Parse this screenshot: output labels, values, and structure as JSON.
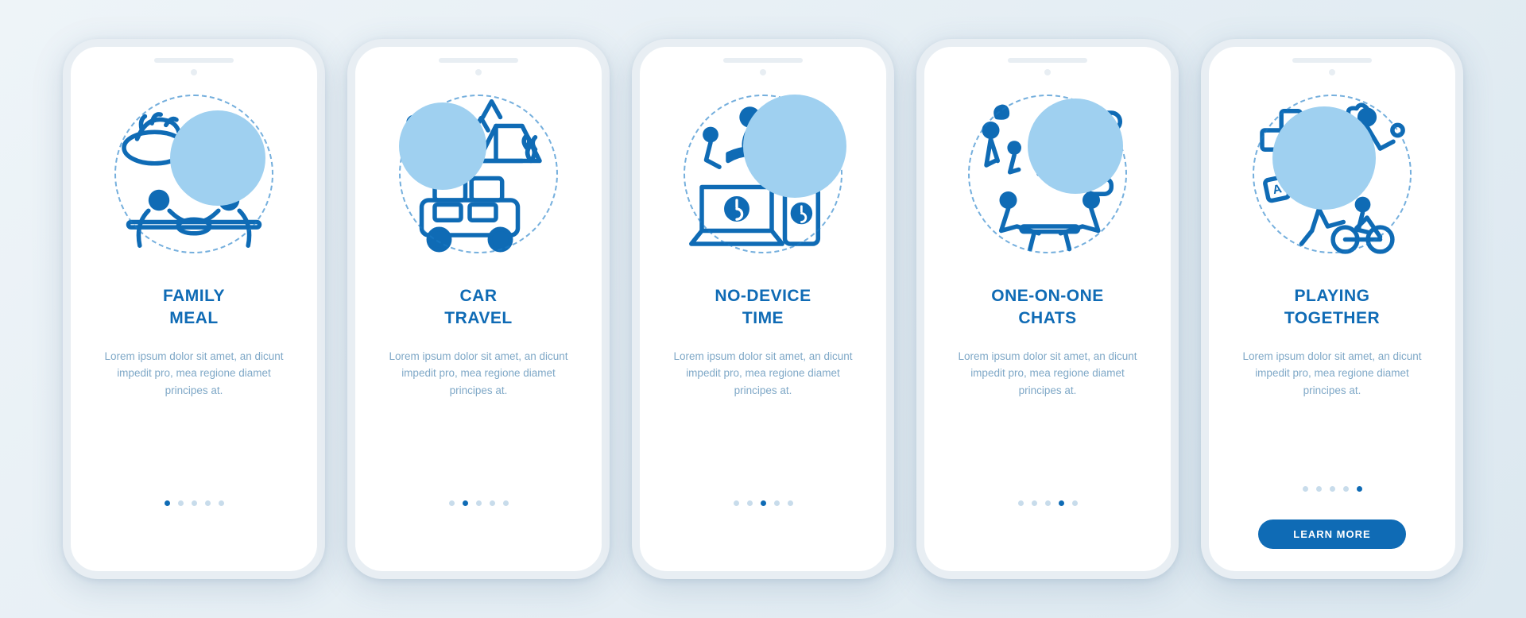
{
  "colors": {
    "accent": "#0f6bb5",
    "accentLight": "#9fd0f0",
    "muted": "#7fa8c7"
  },
  "screens": [
    {
      "id": "family-meal",
      "title": "FAMILY\nMEAL",
      "desc": "Lorem ipsum dolor sit amet, an dicunt impedit pro, mea regione diamet principes at.",
      "activeDot": 0
    },
    {
      "id": "car-travel",
      "title": "CAR\nTRAVEL",
      "desc": "Lorem ipsum dolor sit amet, an dicunt impedit pro, mea regione diamet principes at.",
      "activeDot": 1
    },
    {
      "id": "no-device-time",
      "title": "NO-DEVICE\nTIME",
      "desc": "Lorem ipsum dolor sit amet, an dicunt impedit pro, mea regione diamet principes at.",
      "activeDot": 2
    },
    {
      "id": "one-on-one-chats",
      "title": "ONE-ON-ONE\nCHATS",
      "desc": "Lorem ipsum dolor sit amet, an dicunt impedit pro, mea regione diamet principes at.",
      "activeDot": 3
    },
    {
      "id": "playing-together",
      "title": "PLAYING\nTOGETHER",
      "desc": "Lorem ipsum dolor sit amet, an dicunt impedit pro, mea regione diamet principes at.",
      "activeDot": 4,
      "cta": "LEARN MORE"
    }
  ],
  "dotCount": 5
}
